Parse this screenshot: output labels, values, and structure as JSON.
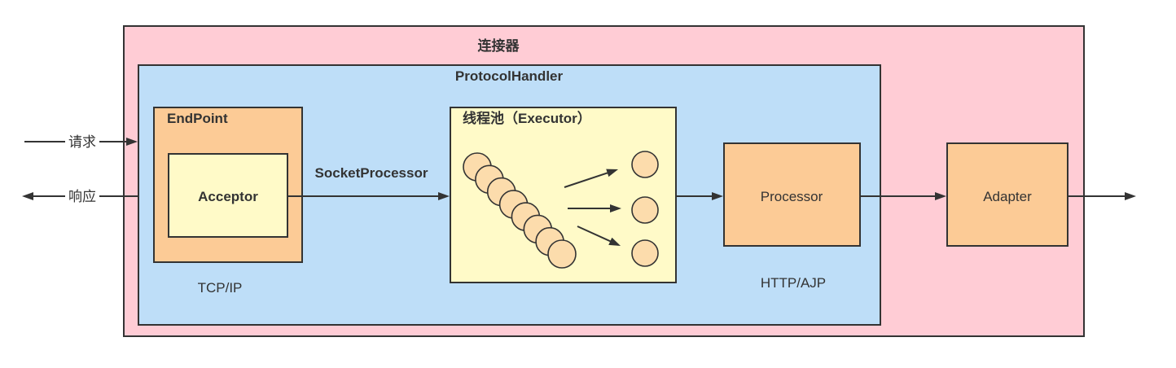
{
  "diagram": {
    "connector_title": "连接器",
    "protocol_handler_title": "ProtocolHandler",
    "endpoint_label": "EndPoint",
    "acceptor_label": "Acceptor",
    "endpoint_protocol": "TCP/IP",
    "socket_processor_label": "SocketProcessor",
    "thread_pool_label": "线程池（Executor）",
    "processor_label": "Processor",
    "processor_protocol": "HTTP/AJP",
    "adapter_label": "Adapter",
    "request_label": "请求",
    "response_label": "响应"
  },
  "colors": {
    "connector_fill": "#FFCCD5",
    "protocol_handler_fill": "#BEDEF8",
    "component_fill": "#FCCB96",
    "inner_fill": "#FFFAC8",
    "thread_fill": "#FCDCAC",
    "stroke": "#333333",
    "text": "#333333"
  }
}
